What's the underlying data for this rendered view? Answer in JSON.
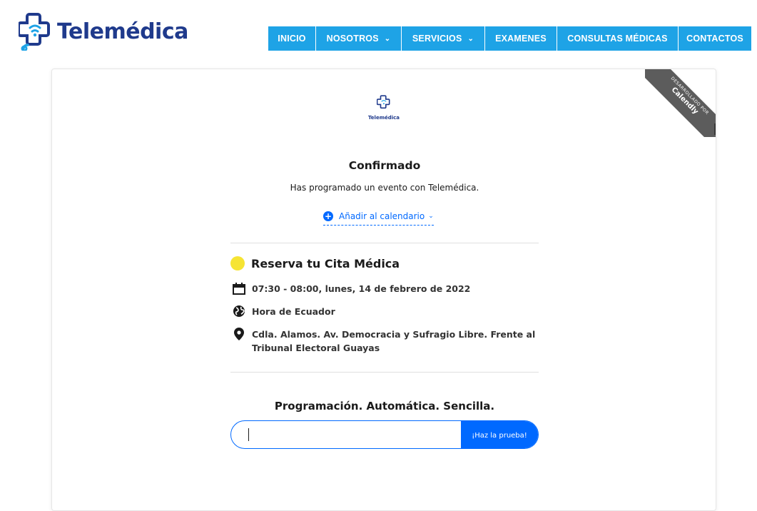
{
  "brand": {
    "name": "Telemédica",
    "primary_color": "#1f3a8c",
    "nav_color": "#1ea3e6"
  },
  "nav": {
    "items": [
      {
        "label": "INICIO",
        "has_caret": false
      },
      {
        "label": "NOSOTROS",
        "has_caret": true
      },
      {
        "label": "SERVICIOS",
        "has_caret": true
      },
      {
        "label": "EXAMENES",
        "has_caret": false
      },
      {
        "label": "CONSULTAS MÉDICAS",
        "has_caret": false
      },
      {
        "label": "CONTACTOS",
        "has_caret": false
      }
    ],
    "caret_glyph": "⌄"
  },
  "ribbon": {
    "small_text": "DESARROLLADO POR",
    "big_text": "Calendly",
    "color": "#5c5c5c"
  },
  "card": {
    "logo_text": "Telemédica",
    "title": "Confirmado",
    "subtitle": "Has programado un evento con Telemédica.",
    "add_calendar": {
      "label": "Añadir al calendario",
      "icon": "plus-circle-icon",
      "chevron": "⌄",
      "color": "#0069ff"
    },
    "event": {
      "name": "Reserva tu Cita Médica",
      "dot_color": "#f6e433",
      "datetime": "07:30 - 08:00, lunes, 14 de febrero de 2022",
      "timezone": "Hora de Ecuador",
      "location": "Cdla. Alamos. Av. Democracia y Sufragio Libre. Frente al Tribunal Electoral Guayas"
    },
    "promo": {
      "title": "Programación. Automática. Sencilla.",
      "input_value": "",
      "button_label": "¡Haz la prueba!",
      "accent_color": "#0069ff"
    }
  }
}
